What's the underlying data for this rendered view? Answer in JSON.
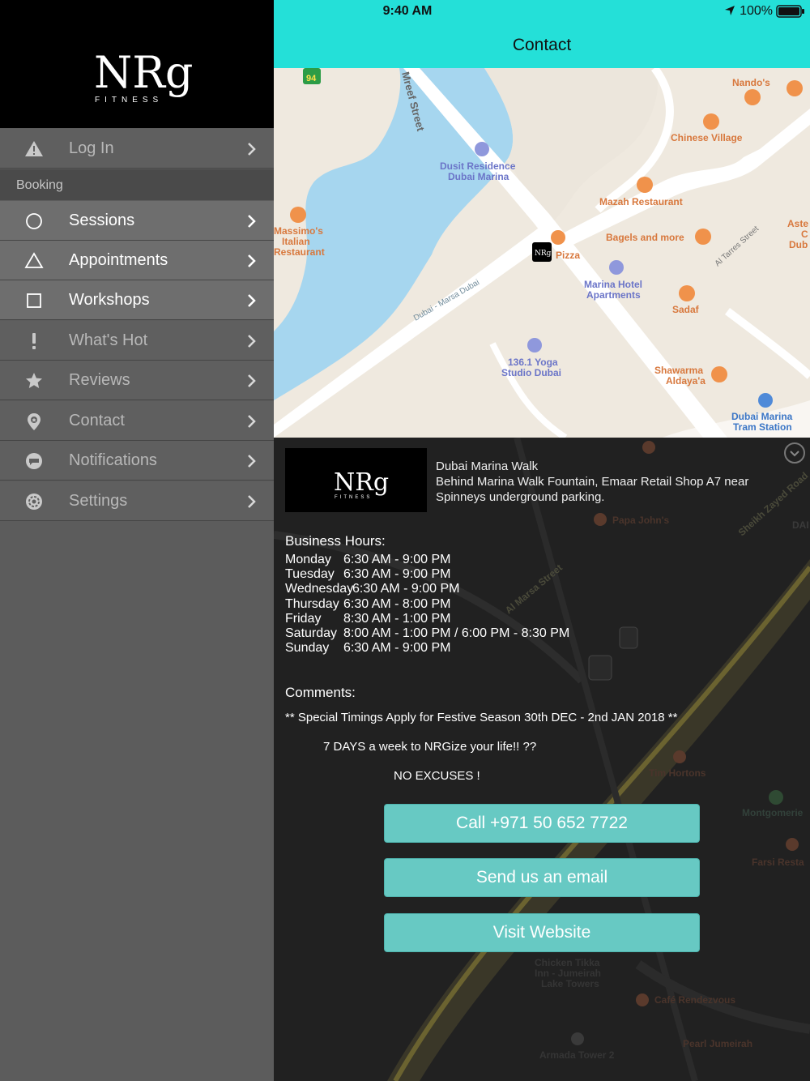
{
  "status": {
    "time": "9:40 AM",
    "battery": "100%"
  },
  "nav": {
    "title": "Contact"
  },
  "logo": {
    "text": "NRg",
    "subtext": "FITNESS"
  },
  "sidebar": {
    "section_booking": "Booking",
    "items": [
      {
        "label": "Log In",
        "icon": "warning-icon",
        "active": false
      },
      {
        "label": "Sessions",
        "icon": "circle-icon",
        "active": true
      },
      {
        "label": "Appointments",
        "icon": "triangle-icon",
        "active": true
      },
      {
        "label": "Workshops",
        "icon": "square-icon",
        "active": true
      },
      {
        "label": "What's Hot",
        "icon": "exclamation-icon",
        "active": false
      },
      {
        "label": "Reviews",
        "icon": "star-icon",
        "active": false
      },
      {
        "label": "Contact",
        "icon": "location-pin-icon",
        "active": false
      },
      {
        "label": "Notifications",
        "icon": "chat-bubble-icon",
        "active": false
      },
      {
        "label": "Settings",
        "icon": "gear-icon",
        "active": false
      }
    ]
  },
  "map": {
    "labels": {
      "nandos": "Nando's",
      "chinese_village": "Chinese Village",
      "dusit1": "Dusit Residence",
      "dusit2": "Dubai Marina",
      "mazah": "Mazah Restaurant",
      "massimo1": "Massimo's",
      "massimo2": "Italian",
      "massimo3": "Restaurant",
      "bagels": "Bagels and more",
      "pizza": "Pizza",
      "marina_hotel1": "Marina Hotel",
      "marina_hotel2": "Apartments",
      "sadaf": "Sadaf",
      "yoga1": "136.1 Yoga",
      "yoga2": "Studio Dubai",
      "shawarma1": "Shawarma",
      "shawarma2": "Aldaya'a",
      "tram1": "Dubai Marina",
      "tram2": "Tram Station",
      "mreef": "Mreef Street",
      "marsa": "Dubai - Marsa Dubai",
      "tarres": "Al Tarres Street",
      "route": "94",
      "aste1": "Aste",
      "aste2": "C",
      "aste3": "Dub"
    }
  },
  "info": {
    "address_title": "Dubai Marina Walk",
    "address_detail": "Behind Marina Walk  Fountain, Emaar Retail Shop A7 near Spinneys underground parking.",
    "hours_title": "Business Hours:",
    "hours": [
      {
        "day": "Monday",
        "time": "6:30 AM - 9:00 PM"
      },
      {
        "day": "Tuesday",
        "time": "6:30 AM - 9:00 PM"
      },
      {
        "day": "Wednesday",
        "time": "6:30 AM - 9:00 PM"
      },
      {
        "day": "Thursday",
        "time": "6:30 AM - 8:00 PM"
      },
      {
        "day": "Friday",
        "time": "8:30 AM - 1:00 PM"
      },
      {
        "day": "Saturday",
        "time": "8:00 AM - 1:00 PM  / 6:00 PM - 8:30 PM"
      },
      {
        "day": "Sunday",
        "time": "6:30 AM - 9:00 PM"
      }
    ],
    "comments_title": "Comments:",
    "comments": [
      "** Special Timings Apply for Festive Season 30th DEC - 2nd JAN 2018 **",
      "7 DAYS a week to NRGize your life!!  ??",
      "NO EXCUSES !"
    ],
    "buttons": {
      "call": "Call +971 50 652 7722",
      "email": "Send us an email",
      "website": "Visit Website"
    },
    "bg_labels": {
      "papa": "Papa John's",
      "tim": "Tim Hortons",
      "montgomerie": "Montgomerie",
      "farsi": "Farsi Resta",
      "marsa_street": "Al Marsa Street",
      "sheikh": "Sheikh Zayed Road",
      "chicken": "Chicken Tikka",
      "inn": "Inn - Jumeirah",
      "lake": "Lake Towers",
      "armada": "Armada Tower 2",
      "cafe": "Café Rendezvous",
      "pearl": "Pearl Jumeirah",
      "dai": "DAI"
    }
  },
  "colors": {
    "accent": "#24e0d8",
    "button": "#67c9c3",
    "sidebar": "#5f5f5f",
    "water": "#a6d6ef"
  }
}
